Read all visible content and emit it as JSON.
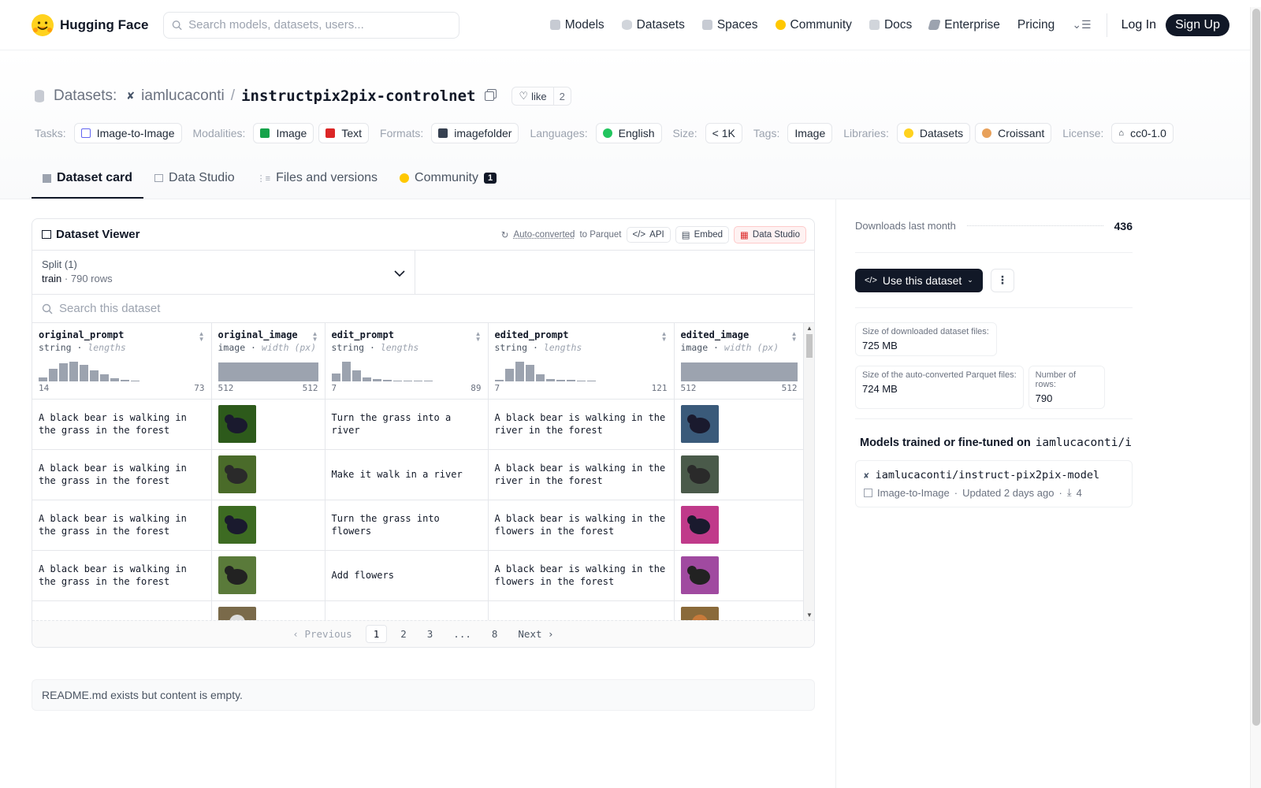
{
  "nav": {
    "brand": "Hugging Face",
    "search_placeholder": "Search models, datasets, users...",
    "links": [
      "Models",
      "Datasets",
      "Spaces",
      "Community",
      "Docs",
      "Enterprise",
      "Pricing"
    ],
    "login": "Log In",
    "signup": "Sign Up"
  },
  "repo": {
    "section": "Datasets:",
    "owner": "iamlucaconti",
    "slash": "/",
    "name": "instructpix2pix-controlnet",
    "like_label": "like",
    "like_count": "2"
  },
  "tags": {
    "tasks_label": "Tasks:",
    "task": "Image-to-Image",
    "modalities_label": "Modalities:",
    "modality1": "Image",
    "modality2": "Text",
    "formats_label": "Formats:",
    "format": "imagefolder",
    "languages_label": "Languages:",
    "language": "English",
    "size_label": "Size:",
    "size": "< 1K",
    "tags_label": "Tags:",
    "tag": "Image",
    "libraries_label": "Libraries:",
    "lib1": "Datasets",
    "lib2": "Croissant",
    "license_label": "License:",
    "license": "cc0-1.0"
  },
  "tabs": {
    "card": "Dataset card",
    "studio": "Data Studio",
    "files": "Files and versions",
    "community": "Community",
    "community_count": "1"
  },
  "viewer": {
    "title": "Dataset Viewer",
    "auto": "Auto-converted",
    "to_parquet": "to Parquet",
    "api": "API",
    "embed": "Embed",
    "studio": "Data Studio",
    "split_label": "Split (1)",
    "split_name": "train",
    "split_rows": "790 rows",
    "search_placeholder": "Search this dataset",
    "columns": [
      {
        "name": "original_prompt",
        "type": "string",
        "stat": "lengths",
        "min": "14",
        "max": "73",
        "hist": [
          0.2,
          0.6,
          0.9,
          0.95,
          0.8,
          0.55,
          0.35,
          0.15,
          0.07,
          0.05
        ]
      },
      {
        "name": "original_image",
        "type": "image",
        "stat": "width (px)",
        "min": "512",
        "max": "512",
        "hist": [
          1
        ]
      },
      {
        "name": "edit_prompt",
        "type": "string",
        "stat": "lengths",
        "min": "7",
        "max": "89",
        "hist": [
          0.4,
          0.95,
          0.55,
          0.2,
          0.1,
          0.06,
          0.04,
          0,
          0,
          0.05
        ]
      },
      {
        "name": "edited_prompt",
        "type": "string",
        "stat": "lengths",
        "min": "7",
        "max": "121",
        "hist": [
          0.08,
          0.6,
          0.95,
          0.8,
          0.35,
          0.12,
          0.08,
          0.06,
          0.05,
          0.05
        ]
      },
      {
        "name": "edited_image",
        "type": "image",
        "stat": "width (px)",
        "min": "512",
        "max": "512",
        "hist": [
          1
        ]
      }
    ],
    "rows": [
      {
        "original_prompt": "A black bear is walking in the grass in the forest",
        "edit_prompt": "Turn the grass into a river",
        "edited_prompt": "A black bear is walking in the river in the forest"
      },
      {
        "original_prompt": "A black bear is walking in the grass in the forest",
        "edit_prompt": "Make it walk in a river",
        "edited_prompt": "A black bear is walking in the river in the forest"
      },
      {
        "original_prompt": "A black bear is walking in the grass in the forest",
        "edit_prompt": "Turn the grass into flowers",
        "edited_prompt": "A black bear is walking in the flowers in the forest"
      },
      {
        "original_prompt": "A black bear is walking in the grass in the forest",
        "edit_prompt": "Add flowers",
        "edited_prompt": "A black bear is walking in the flowers in the forest"
      }
    ],
    "pager": {
      "prev": "Previous",
      "next": "Next",
      "pages": [
        "1",
        "2",
        "3",
        "...",
        "8"
      ]
    }
  },
  "readme": "README.md exists but content is empty.",
  "side": {
    "downloads_label": "Downloads last month",
    "downloads": "436",
    "use_btn": "Use this dataset",
    "stat1_k": "Size of downloaded dataset files:",
    "stat1_v": "725 MB",
    "stat2_k": "Size of the auto-converted Parquet files:",
    "stat2_v": "724 MB",
    "stat3_k": "Number of rows:",
    "stat3_v": "790",
    "models_title": "Models trained or fine-tuned on",
    "models_repo": "iamlucaconti/i...",
    "model_name": "iamlucaconti/instruct-pix2pix-model",
    "model_task": "Image-to-Image",
    "model_updated": "Updated 2 days ago",
    "model_downloads": "4"
  }
}
